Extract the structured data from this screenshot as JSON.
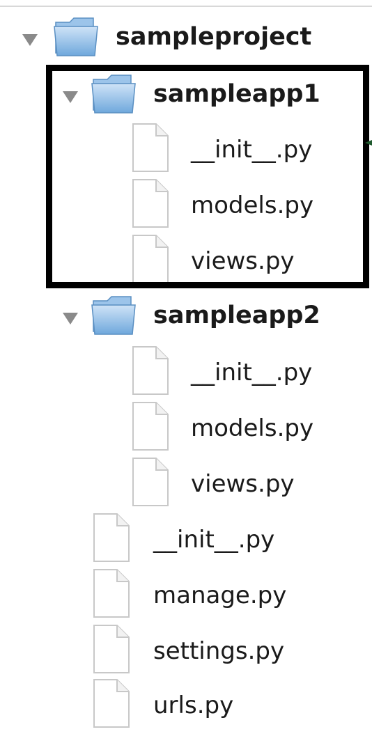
{
  "tree": {
    "root": {
      "label": "sampleproject",
      "children": {
        "sampleapp1": {
          "label": "sampleapp1",
          "files": [
            "__init__.py",
            "models.py",
            "views.py"
          ]
        },
        "sampleapp2": {
          "label": "sampleapp2",
          "files": [
            "__init__.py",
            "models.py",
            "views.py"
          ]
        },
        "files": [
          "__init__.py",
          "manage.py",
          "settings.py",
          "urls.py"
        ]
      }
    }
  },
  "colors": {
    "highlight_border": "#000000",
    "arrow": "#1f5a2e",
    "triangle": "#8a8a8a"
  },
  "icons": {
    "folder": "folder-icon",
    "file": "file-icon",
    "disclosure": "disclosure-triangle-icon"
  }
}
